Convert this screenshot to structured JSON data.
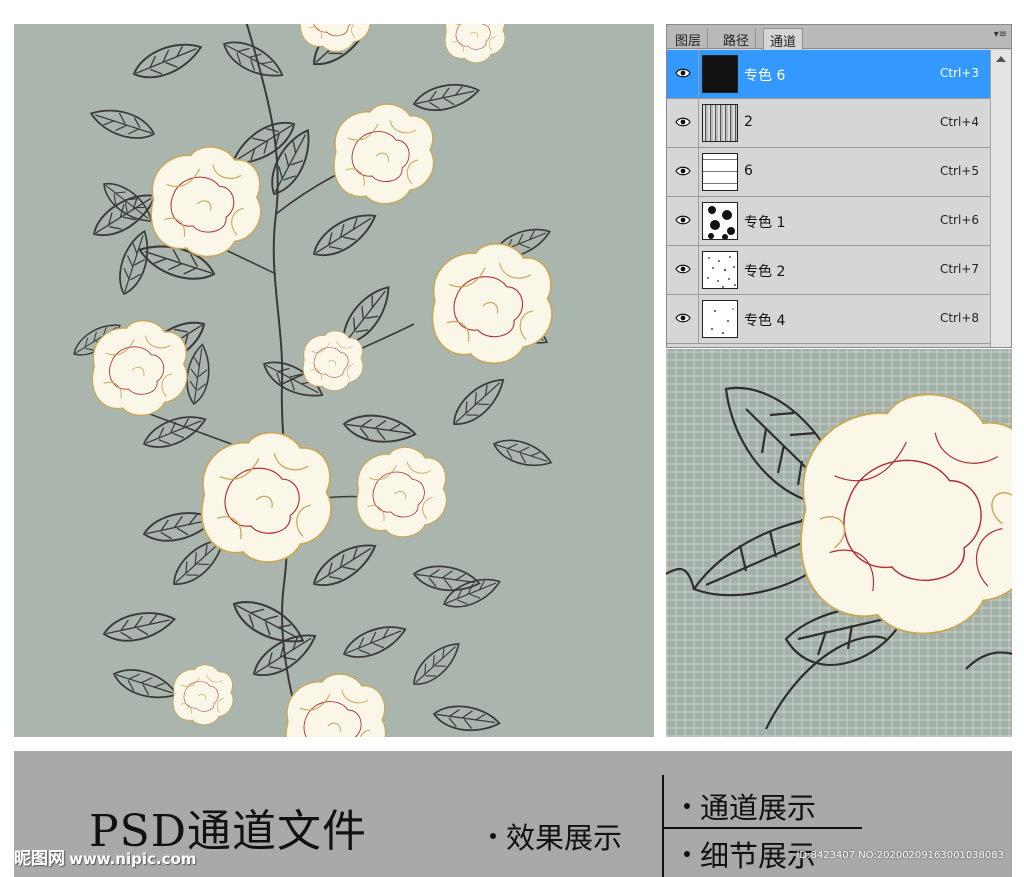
{
  "panel": {
    "tabs": [
      {
        "label": "图层"
      },
      {
        "label": "路径"
      },
      {
        "label": "通道"
      }
    ],
    "menu_glyph": "▾≡",
    "channels": [
      {
        "name": "专色 6",
        "shortcut": "Ctrl+3",
        "selected": true,
        "thumb": "solid-black"
      },
      {
        "name": "2",
        "shortcut": "Ctrl+4",
        "selected": false,
        "thumb": "vertical-stripes"
      },
      {
        "name": "6",
        "shortcut": "Ctrl+5",
        "selected": false,
        "thumb": "dashes"
      },
      {
        "name": "专色 1",
        "shortcut": "Ctrl+6",
        "selected": false,
        "thumb": "blots"
      },
      {
        "name": "专色 2",
        "shortcut": "Ctrl+7",
        "selected": false,
        "thumb": "speckles"
      },
      {
        "name": "专色 4",
        "shortcut": "Ctrl+8",
        "selected": false,
        "thumb": "sparse-speckles"
      }
    ],
    "selection_color": "#3399ff"
  },
  "banner": {
    "title": "PSD通道文件",
    "effect_label": "效果展示",
    "channel_label": "通道展示",
    "detail_label": "细节展示"
  },
  "watermark": {
    "brand": "昵图网",
    "url": "www.nipic.com",
    "image_id": "ID:8423407 NO:20200209163001038083"
  },
  "colors": {
    "background_fabric": "#a7b3ab",
    "flower_fill": "#fbf7e8",
    "flower_outline": "#c9a85a",
    "flower_accent": "#b0303a",
    "leaf_ink": "#3a3a3a",
    "banner": "#a9a9a9"
  },
  "icons": {
    "visibility": "eye-icon",
    "panel_menu": "panel-menu-icon"
  }
}
